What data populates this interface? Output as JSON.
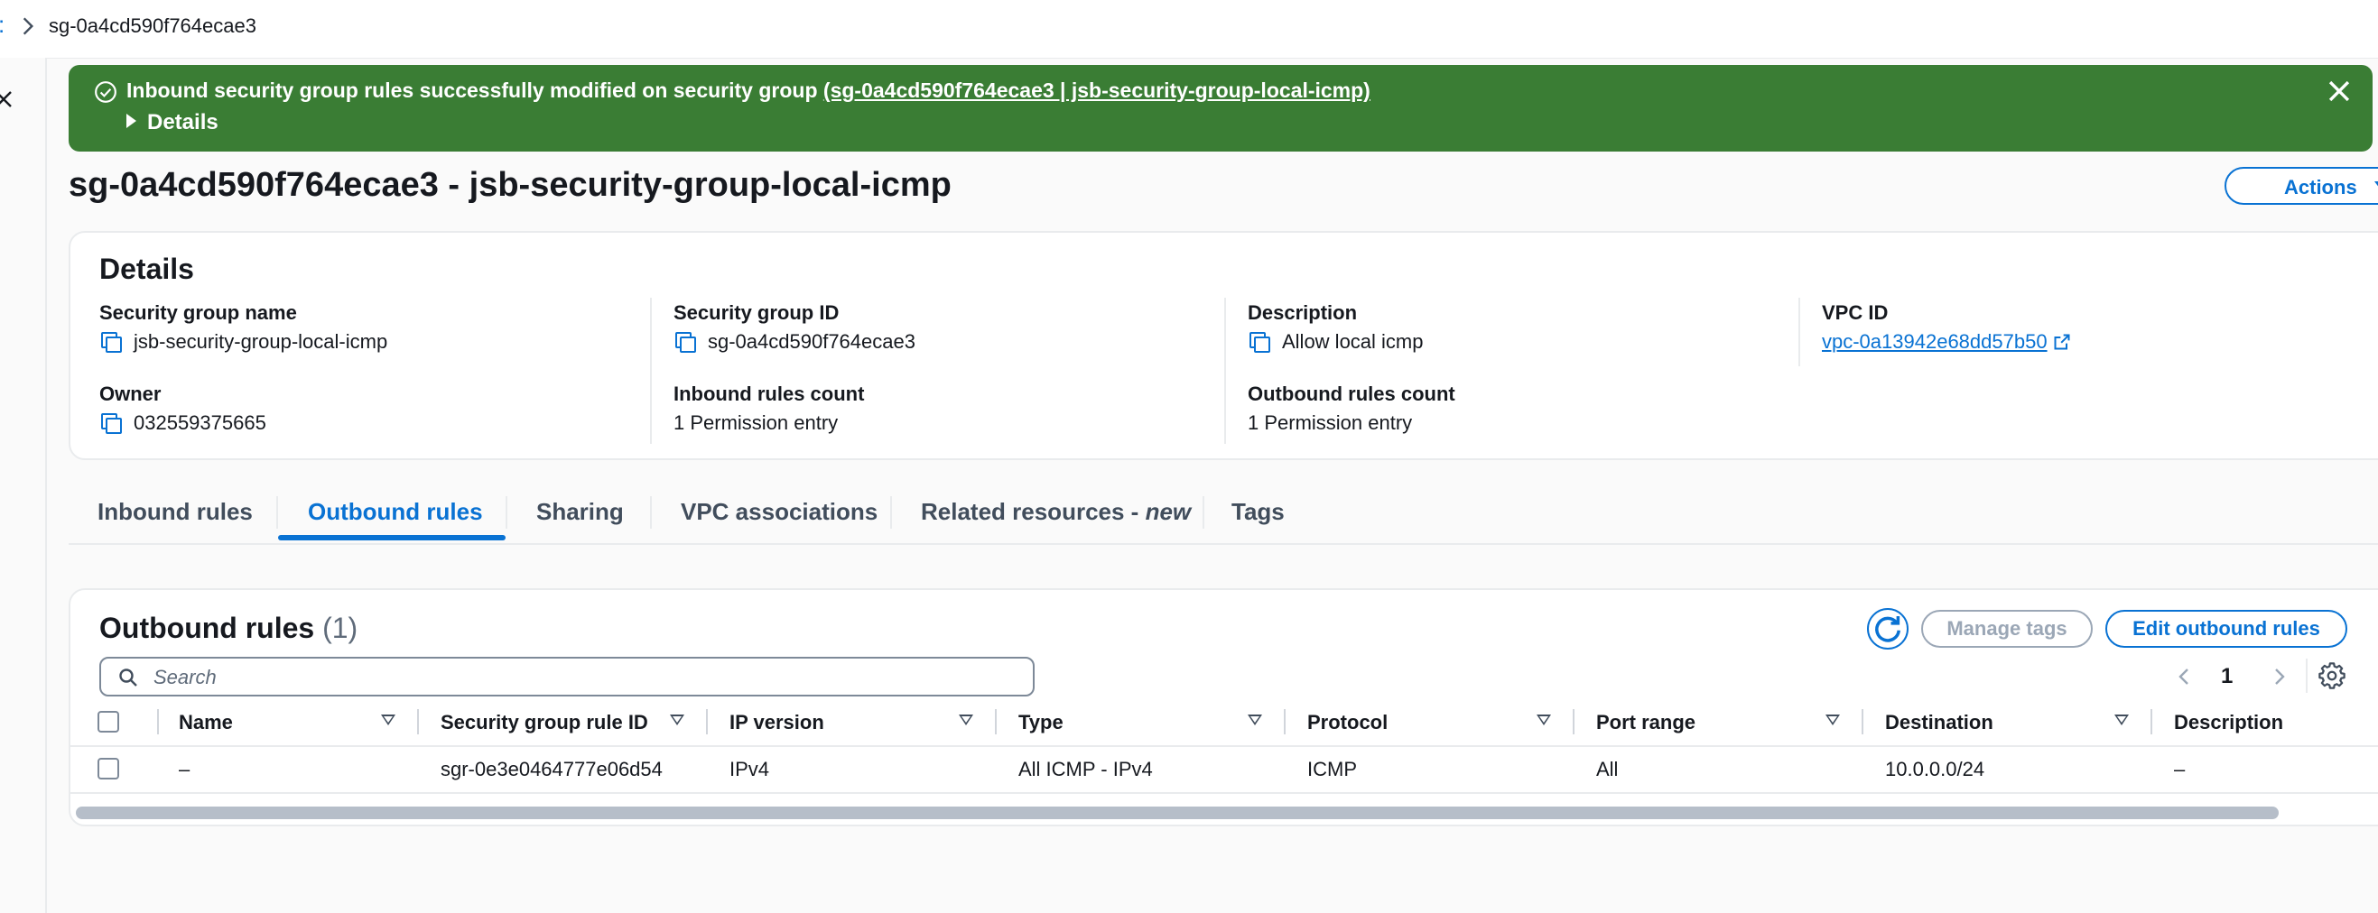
{
  "breadcrumb": {
    "fragment": ":",
    "current": "sg-0a4cd590f764ecae3"
  },
  "flash": {
    "message": "Inbound security group rules successfully modified on security group",
    "link": "(sg-0a4cd590f764ecae3 | jsb-security-group-local-icmp)",
    "details_label": "Details",
    "color": "#3a7d34"
  },
  "page": {
    "title": "sg-0a4cd590f764ecae3 - jsb-security-group-local-icmp",
    "actions_label": "Actions"
  },
  "details": {
    "heading": "Details",
    "sg_name_label": "Security group name",
    "sg_name": "jsb-security-group-local-icmp",
    "sg_id_label": "Security group ID",
    "sg_id": "sg-0a4cd590f764ecae3",
    "description_label": "Description",
    "description": "Allow local icmp",
    "vpc_label": "VPC ID",
    "vpc_id": "vpc-0a13942e68dd57b50",
    "owner_label": "Owner",
    "owner": "032559375665",
    "inbound_count_label": "Inbound rules count",
    "inbound_count": "1 Permission entry",
    "outbound_count_label": "Outbound rules count",
    "outbound_count": "1 Permission entry"
  },
  "tabs": {
    "inbound": "Inbound rules",
    "outbound": "Outbound rules",
    "sharing": "Sharing",
    "vpc_assoc": "VPC associations",
    "related": "Related resources - ",
    "related_new": "new",
    "tags": "Tags",
    "active": "Outbound rules"
  },
  "rules": {
    "heading": "Outbound rules",
    "count": "(1)",
    "manage_tags": "Manage tags",
    "edit": "Edit outbound rules",
    "search_placeholder": "Search",
    "page": "1",
    "columns": [
      "Name",
      "Security group rule ID",
      "IP version",
      "Type",
      "Protocol",
      "Port range",
      "Destination",
      "Description"
    ],
    "rows": [
      [
        "–",
        "sgr-0e3e0464777e06d54",
        "IPv4",
        "All ICMP - IPv4",
        "ICMP",
        "All",
        "10.0.0.0/24",
        "–"
      ]
    ]
  },
  "colors": {
    "accent": "#0972d3",
    "success": "#3a7d34",
    "border": "#e9ebed"
  },
  "icons": [
    "chevron-right-icon",
    "close-icon",
    "check-circle-icon",
    "caret-right-icon",
    "caret-down-icon",
    "copy-icon",
    "external-link-icon",
    "refresh-icon",
    "search-icon",
    "chevron-left-icon",
    "settings-icon",
    "sort-icon"
  ]
}
